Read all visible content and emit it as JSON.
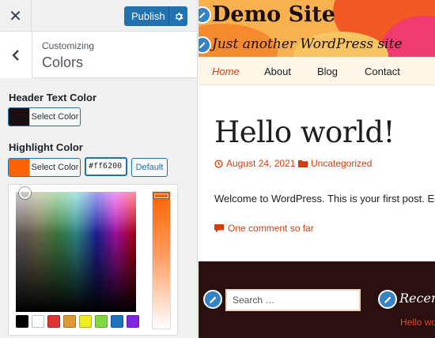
{
  "customizer": {
    "publish_label": "Publish",
    "section_breadcrumb": "Customizing",
    "section_title": "Colors",
    "header_text_color": {
      "label": "Header Text Color",
      "button_label": "Select Color",
      "value": "#1b0e0e"
    },
    "highlight_color": {
      "label": "Highlight Color",
      "button_label": "Select Color",
      "value": "#ff6200",
      "hex_input_value": "#ff6200",
      "default_label": "Default"
    },
    "palette": [
      "#000000",
      "#ffffff",
      "#dd3333",
      "#dd9933",
      "#eeee22",
      "#81d742",
      "#1e73be",
      "#8224e3"
    ]
  },
  "site": {
    "title": "Demo Site",
    "tagline": "Just another WordPress site",
    "nav": [
      "Home",
      "About",
      "Blog",
      "Contact"
    ],
    "post": {
      "title": "Hello world!",
      "date": "August 24, 2021",
      "category": "Uncategorized",
      "excerpt": "Welcome to WordPress. This is your first post. Edit",
      "comments": "One comment so far"
    },
    "footer": {
      "search_placeholder": "Search …",
      "widget_title": "Recent",
      "widget_link": "Hello wor"
    }
  },
  "colors": {
    "accent": "#2271b1",
    "highlight": "#ff6200",
    "header_text": "#1b0e0e",
    "link": "#d63b09",
    "footer_bg": "#2a0f0f"
  }
}
